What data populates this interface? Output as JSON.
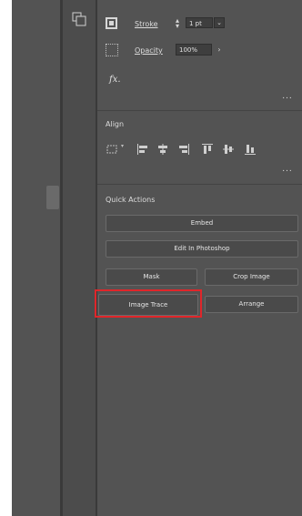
{
  "properties_panel": {
    "appearance": {
      "stroke_label": "Stroke",
      "stroke_value": "1 pt",
      "opacity_label": "Opacity",
      "opacity_value": "100%",
      "fx_label": "fx.",
      "more_label": "..."
    },
    "align": {
      "title": "Align",
      "more_label": "..."
    },
    "quick_actions": {
      "title": "Quick Actions",
      "buttons": {
        "embed": "Embed",
        "edit_in_photoshop": "Edit In Photoshop",
        "mask": "Mask",
        "crop_image": "Crop Image",
        "image_trace": "Image Trace",
        "arrange": "Arrange"
      }
    }
  },
  "colors": {
    "panel_bg": "#535353",
    "button_bg": "#4a4a4a",
    "highlight": "#e0262a"
  },
  "icons": {
    "toolbar": "artboards-icon",
    "stroke": "stroke-swatch-icon",
    "opacity": "opacity-icon",
    "appearance": "fx-icon",
    "align": [
      "align-to-selection-icon",
      "horizontal-align-left-icon",
      "horizontal-align-center-icon",
      "horizontal-align-right-icon",
      "vertical-align-top-icon",
      "vertical-align-center-icon",
      "vertical-align-bottom-icon"
    ]
  }
}
